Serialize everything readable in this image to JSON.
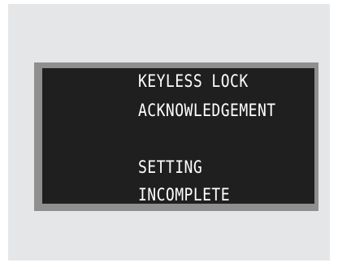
{
  "display": {
    "lines": [
      "KEYLESS LOCK",
      "ACKNOWLEDGEMENT",
      "SETTING",
      "INCOMPLETE"
    ]
  },
  "colors": {
    "background_panel": "#e4e6e8",
    "bezel": "#8f8f8f",
    "screen": "#201f1f",
    "text": "#ffffff"
  }
}
